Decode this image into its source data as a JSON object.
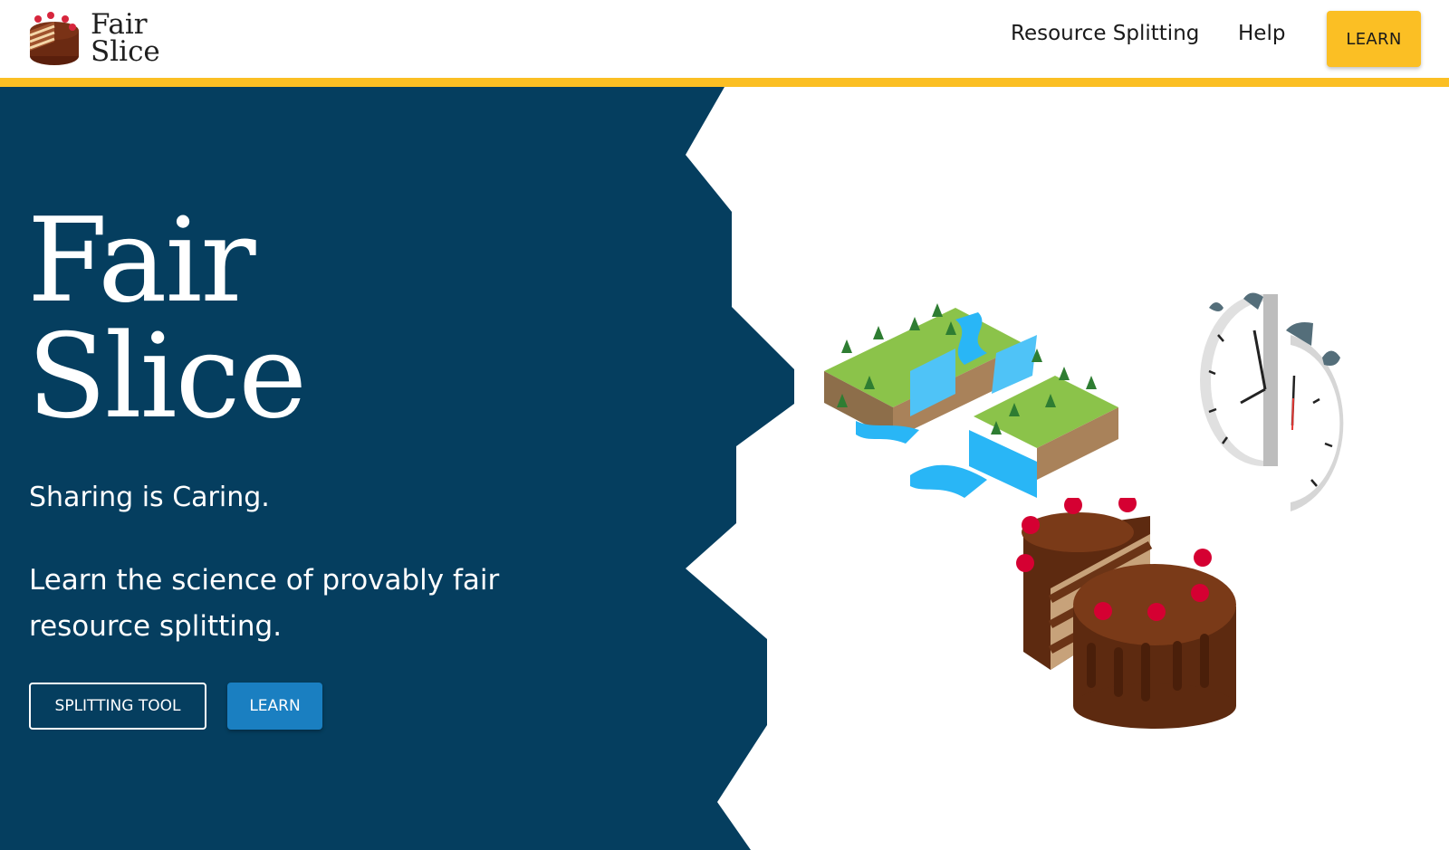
{
  "brand": {
    "line1": "Fair",
    "line2": "Slice",
    "logo_icon": "cake-logo-icon"
  },
  "nav": {
    "resource_splitting": "Resource Splitting",
    "help": "Help",
    "learn_button": "LEARN"
  },
  "hero": {
    "title_line1": "Fair",
    "title_line2": "Slice",
    "tagline": "Sharing is Caring.",
    "description": "Learn the science of provably fair resource splitting.",
    "splitting_tool_button": "SPLITTING TOOL",
    "learn_button": "LEARN"
  },
  "illustrations": [
    "land-split-icon",
    "clock-split-icon",
    "cake-split-icon"
  ],
  "colors": {
    "navy": "#053e5f",
    "accent_yellow": "#fbbf24",
    "learn_blue": "#1a7fc1",
    "white": "#ffffff"
  }
}
